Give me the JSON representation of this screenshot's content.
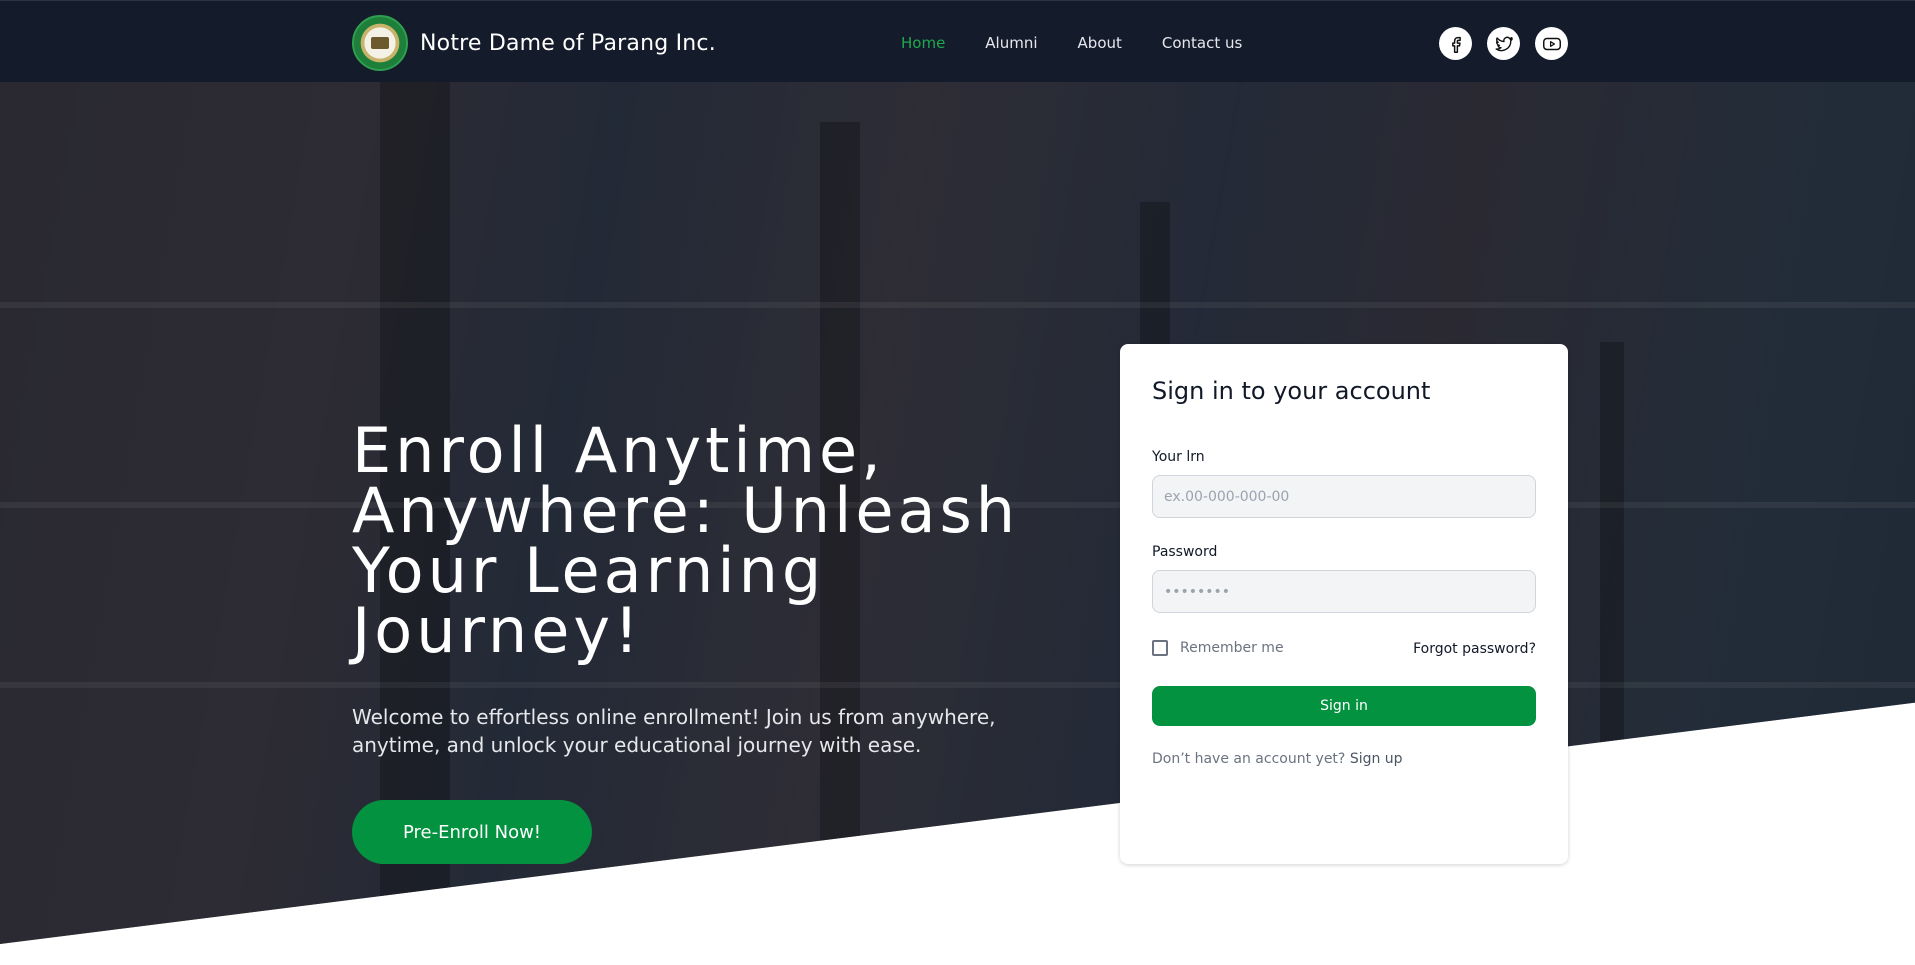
{
  "nav": {
    "brand": "Notre Dame of Parang Inc.",
    "links": [
      {
        "label": "Home",
        "active": true
      },
      {
        "label": "Alumni",
        "active": false
      },
      {
        "label": "About",
        "active": false
      },
      {
        "label": "Contact us",
        "active": false
      }
    ],
    "socials": [
      "facebook-icon",
      "twitter-icon",
      "youtube-icon"
    ]
  },
  "hero": {
    "title_lines": [
      "Enroll Anytime,",
      "Anywhere: Unleash",
      "Your Learning",
      "Journey!"
    ],
    "subtitle_lines": [
      "Welcome to effortless online enrollment! Join us from anywhere,",
      "anytime, and unlock your educational journey with ease."
    ],
    "cta": "Pre-Enroll Now!"
  },
  "signin": {
    "title": "Sign in to your account",
    "lrn_label": "Your lrn",
    "lrn_placeholder": "ex.00-000-000-00",
    "password_label": "Password",
    "password_value": "••••••••",
    "remember_label": "Remember me",
    "forgot": "Forgot password?",
    "button": "Sign in",
    "signup_prompt": "Don’t have an account yet?",
    "signup_link": "Sign up"
  },
  "colors": {
    "navbar": "#141b2b",
    "accent": "#03923f",
    "active_link": "#1fa84f"
  }
}
